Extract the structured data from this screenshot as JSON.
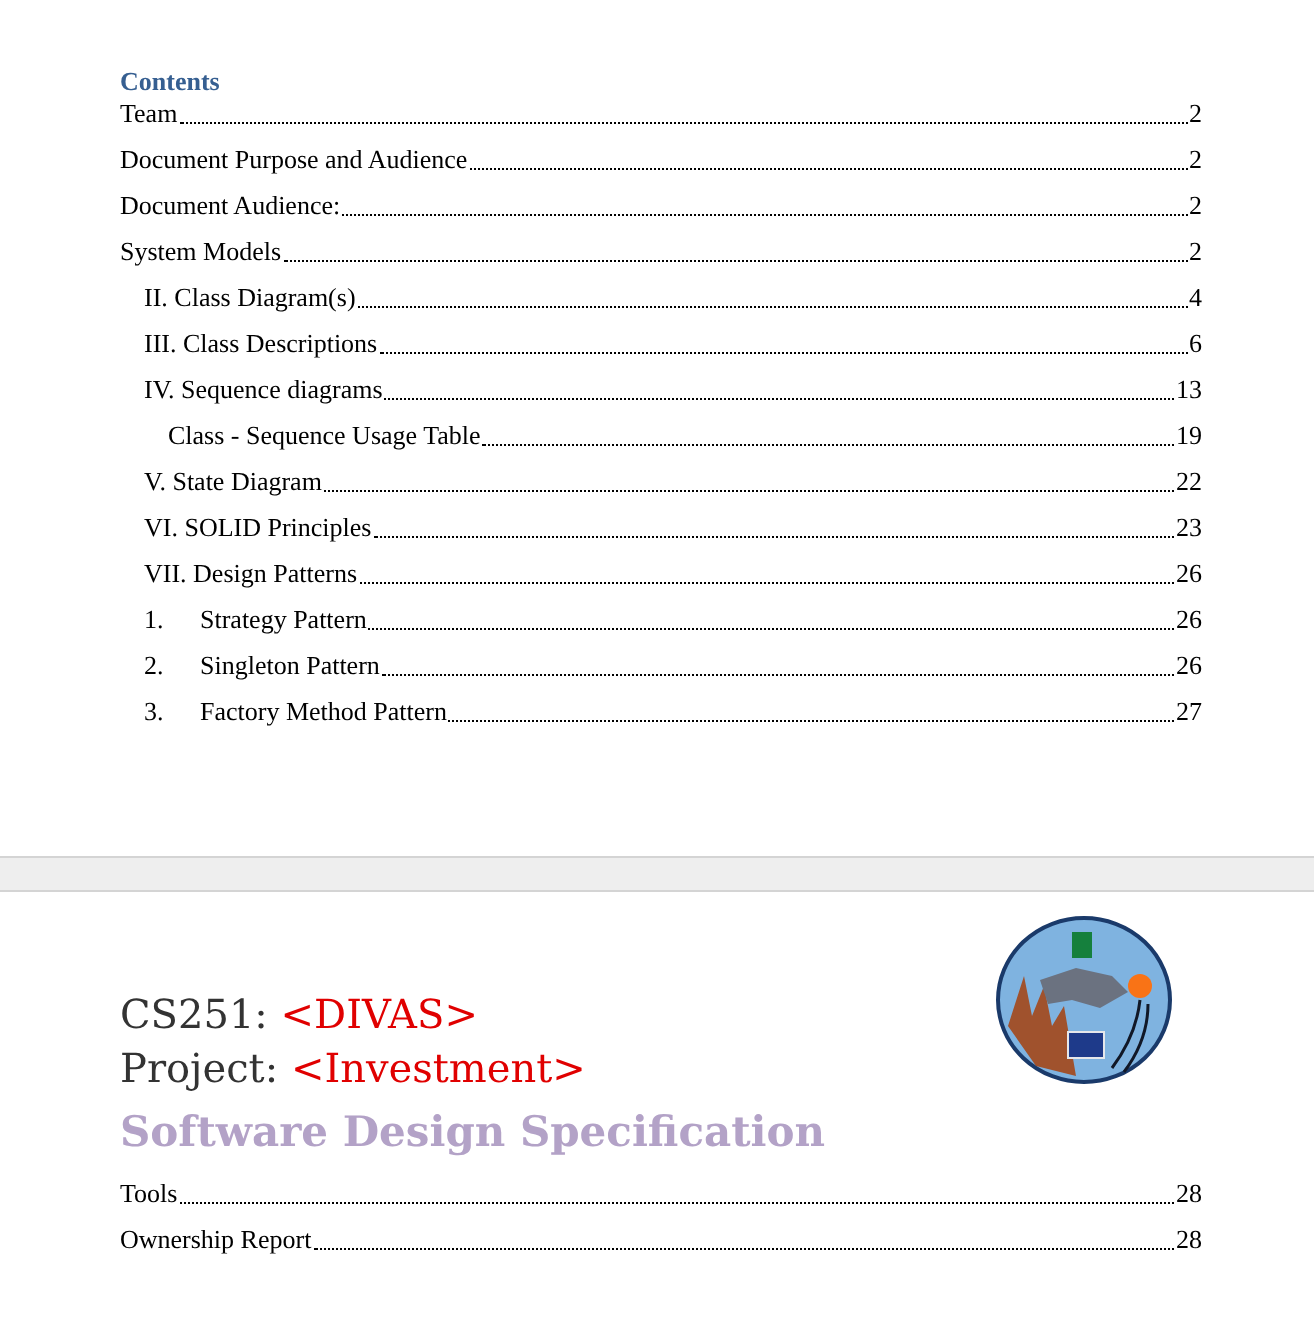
{
  "pages": [
    {
      "toc_title": "Contents",
      "toc": [
        {
          "text": "Team",
          "page": "2"
        },
        {
          "text": "Document Purpose and Audience",
          "page": "2"
        },
        {
          "text": "Document Audience:",
          "page": "2"
        },
        {
          "text": "System Models",
          "page": "2",
          "children": [
            {
              "text": "II. Class Diagram(s)",
              "page": "4"
            },
            {
              "text": "III. Class Descriptions",
              "page": "6"
            },
            {
              "text": "IV. Sequence diagrams",
              "page": "13",
              "children": [
                {
                  "text": "Class - Sequence Usage Table",
                  "page": "19"
                }
              ]
            },
            {
              "text": "V. State Diagram",
              "page": "22"
            },
            {
              "text": "VI. SOLID Principles",
              "page": "23"
            },
            {
              "text": "VII. Design Patterns",
              "page": "26"
            },
            {
              "number": "1.",
              "text": "Strategy Pattern",
              "page": "26"
            },
            {
              "number": "2.",
              "text": "Singleton Pattern",
              "page": "26"
            },
            {
              "number": "3.",
              "text": "Factory Method Pattern",
              "page": "27"
            }
          ]
        }
      ]
    },
    {
      "course_label": "CS251:",
      "course_value": "<DIVAS>",
      "project_label": "Project:",
      "project_value": "<Investment>",
      "title": "Software Design Specification",
      "toc": [
        {
          "text": "Tools",
          "page": "28"
        },
        {
          "text": "Ownership Report",
          "page": "28"
        }
      ]
    }
  ]
}
